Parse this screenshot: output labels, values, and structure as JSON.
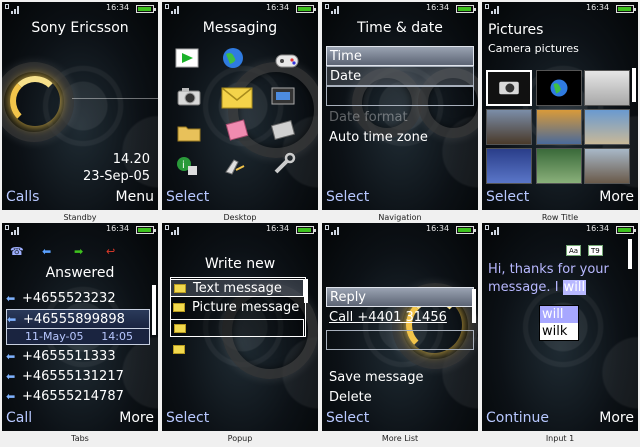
{
  "status": {
    "time": "16:34"
  },
  "screens": {
    "standby": {
      "caption": "Standby",
      "operator": "Sony Ericsson",
      "clock": "14.20",
      "date": "23-Sep-05",
      "soft_left": "Calls",
      "soft_right": "Menu"
    },
    "desktop": {
      "caption": "Desktop",
      "title": "Messaging",
      "soft_left": "Select",
      "icons": [
        "play-icon",
        "internet-icon",
        "games-icon",
        "camera-icon",
        "messaging-icon",
        "media-icon",
        "files-icon",
        "organizer-icon",
        "entertainment-icon",
        "contacts-icon",
        "calls-icon",
        "settings-icon"
      ]
    },
    "navigation": {
      "caption": "Navigation",
      "title": "Time & date",
      "items": [
        "Time",
        "Date",
        "",
        "Date format",
        "Auto time zone"
      ],
      "soft_left": "Select"
    },
    "rowtitle": {
      "caption": "Row Title",
      "title": "Pictures",
      "subtitle": "Camera pictures",
      "soft_left": "Select",
      "soft_right": "More"
    },
    "tabs": {
      "caption": "Tabs",
      "title": "Answered",
      "calls": [
        "+4655523232",
        "+46555899898",
        "+4655511333",
        "+46555131217",
        "+46555214787"
      ],
      "selected_date": "11-May-05",
      "selected_time": "14:05",
      "soft_left": "Call",
      "soft_right": "More"
    },
    "popup": {
      "caption": "Popup",
      "title": "Write new",
      "items": [
        "Text message",
        "Picture message",
        "",
        ""
      ],
      "soft_left": "Select"
    },
    "morelist": {
      "caption": "More List",
      "items": [
        "Reply",
        "Call +4401 31456",
        "",
        "Save message",
        "Delete"
      ],
      "soft_left": "Select"
    },
    "input": {
      "caption": "Input 1",
      "text_before": "Hi, thanks for your message. I ",
      "text_current": "will",
      "suggestions": [
        "will",
        "wilk"
      ],
      "ime_a": "Aa",
      "ime_b": "T9",
      "soft_left": "Continue",
      "soft_right": "More"
    }
  }
}
